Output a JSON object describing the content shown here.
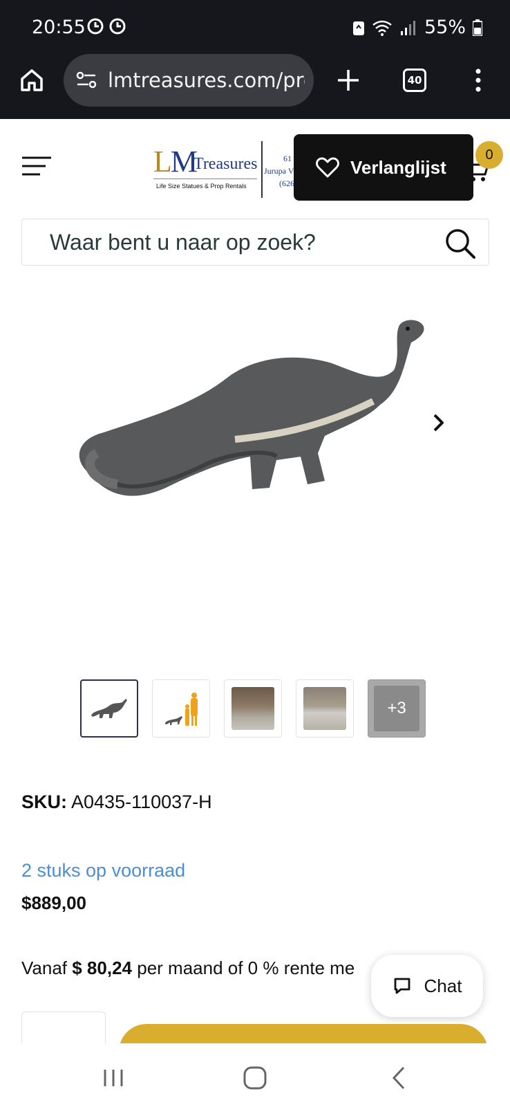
{
  "status_bar": {
    "time": "20:55",
    "battery": "55%"
  },
  "browser": {
    "url": "lmtreasures.com/pro",
    "tab_count": "40"
  },
  "header": {
    "logo": {
      "lm": "LM",
      "treasures": "Treasures",
      "tagline": "Life Size Statues & Prop Rentals",
      "address_line1": "61",
      "address_line2": "Jurupa V",
      "address_line3": "(626"
    },
    "wishlist_label": "Verlanglijst",
    "cart_count": "0"
  },
  "search": {
    "placeholder": "Waar bent u naar op zoek?"
  },
  "gallery": {
    "main_image": "brontosaurus-statue",
    "thumbnails": [
      "brontosaurus",
      "size-comparison",
      "photo-with-person",
      "photo-floor",
      "more"
    ],
    "more_label": "+3"
  },
  "product": {
    "sku_label": "SKU:",
    "sku_value": "A0435-110037-H",
    "stock": "2 stuks op voorraad",
    "price": "$889,00",
    "financing_prefix": "Vanaf",
    "financing_amount": "$ 80,24",
    "financing_suffix": "per maand of 0 % rente me"
  },
  "chat": {
    "label": "Chat"
  },
  "colors": {
    "accent": "#d9ad2e",
    "stock_blue": "#4b8ed6",
    "chrome_bg": "#15171c"
  }
}
